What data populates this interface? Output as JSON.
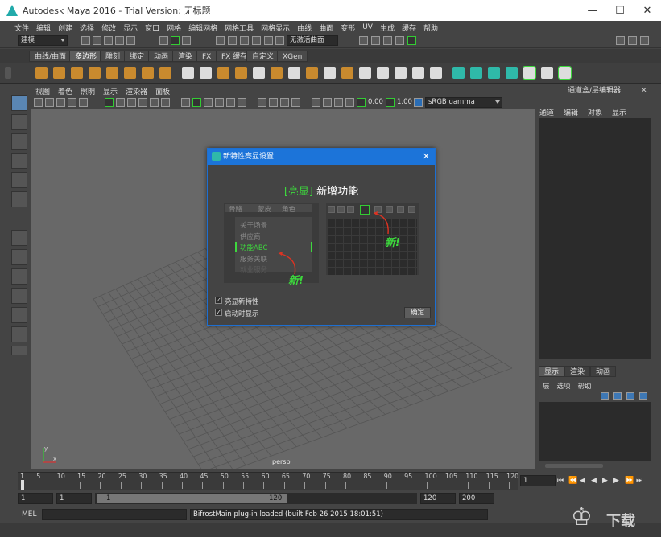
{
  "window": {
    "title": "Autodesk Maya 2016 - Trial Version: 无标题",
    "minimize": "—",
    "maximize": "☐",
    "close": "✕"
  },
  "menubar": [
    "文件",
    "编辑",
    "创建",
    "选择",
    "修改",
    "显示",
    "窗口",
    "网格",
    "编辑网格",
    "网格工具",
    "网格显示",
    "曲线",
    "曲面",
    "变形",
    "UV",
    "生成",
    "缓存",
    "帮助"
  ],
  "statusline": {
    "mode": "建模",
    "no_live": "无激活曲面"
  },
  "shelf_tabs": [
    "曲线/曲面",
    "多边形",
    "雕刻",
    "绑定",
    "动画",
    "渲染",
    "FX",
    "FX 缓存",
    "自定义",
    "XGen"
  ],
  "shelf_selected": "多边形",
  "viewport": {
    "menu": [
      "视图",
      "着色",
      "照明",
      "显示",
      "渲染器",
      "面板"
    ],
    "field1": "0.00",
    "field2": "1.00",
    "colorspace": "sRGB gamma",
    "camera": "persp",
    "axis_y": "y",
    "axis_x": "x"
  },
  "rightpanel": {
    "header": "通道盒/层编辑器",
    "menu": [
      "通道",
      "编辑",
      "对象",
      "显示"
    ],
    "layer_tabs": [
      "显示",
      "渲染",
      "动画"
    ],
    "layer_menu": [
      "层",
      "选项",
      "帮助"
    ]
  },
  "timeline": {
    "ticks": [
      "1",
      "5",
      "10",
      "15",
      "20",
      "25",
      "30",
      "35",
      "40",
      "45",
      "50",
      "55",
      "60",
      "65",
      "70",
      "75",
      "80",
      "85",
      "90",
      "95",
      "100",
      "105",
      "110",
      "115",
      "120"
    ],
    "current": "1",
    "start": "1",
    "start2": "1",
    "range_start": "1",
    "range_end": "120",
    "end": "120",
    "end2": "200"
  },
  "cmdline": {
    "lang": "MEL",
    "message": "BifrostMain plug-in loaded (built Feb 26 2015 18:01:51)"
  },
  "dialog": {
    "title": "新特性亮显设置",
    "close": "✕",
    "heading_bracket": "[亮显]",
    "heading_text": "新增功能",
    "left_tabs": [
      "骨骼",
      "蒙皮",
      "角色"
    ],
    "left_items": [
      "关于场景",
      "供应商",
      "功能ABC",
      "服务关联",
      "就业服务"
    ],
    "new_mark": "新!",
    "show_new_label": "亮显新特性",
    "show_startup_label": "启动时显示",
    "ok_label": "确定",
    "checkmark": "✓"
  },
  "watermark": "下载",
  "colors": {
    "accent": "#1c74d9",
    "highlight_green": "#3dd83d",
    "maya_teal": "#2fb9a9"
  }
}
